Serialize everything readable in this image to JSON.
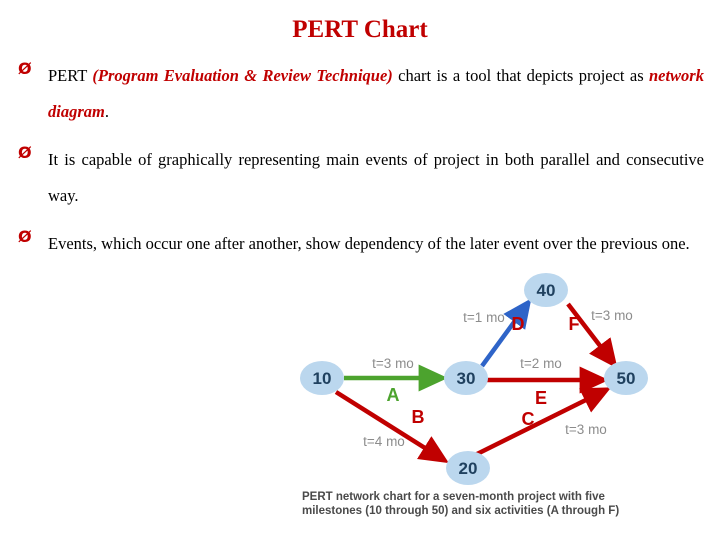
{
  "slide": {
    "title": "PERT Chart",
    "bullet_marker": "Ø",
    "bullets": [
      {
        "segments": [
          {
            "text": "PERT ",
            "style": "plain"
          },
          {
            "text": "(Program Evaluation & Review Technique)",
            "style": "red-bold-italic"
          },
          {
            "text": " chart is a tool that depicts project as ",
            "style": "plain"
          },
          {
            "text": "network diagram",
            "style": "red-bold-italic"
          },
          {
            "text": ".",
            "style": "plain"
          }
        ]
      },
      {
        "segments": [
          {
            "text": "It is capable of graphically representing main events of project in both parallel and consecutive way.",
            "style": "plain"
          }
        ]
      },
      {
        "segments": [
          {
            "text": "Events, which occur one after another, show dependency of the later event over the previous one.",
            "style": "plain"
          }
        ]
      }
    ]
  },
  "diagram": {
    "nodes": [
      {
        "id": "10",
        "label": "10"
      },
      {
        "id": "20",
        "label": "20"
      },
      {
        "id": "30",
        "label": "30"
      },
      {
        "id": "40",
        "label": "40"
      },
      {
        "id": "50",
        "label": "50"
      }
    ],
    "activities": [
      {
        "name": "A",
        "duration": "t=3 mo",
        "from": "10",
        "to": "30",
        "color": "#4CA32E"
      },
      {
        "name": "B",
        "duration": "t=4 mo",
        "from": "10",
        "to": "20",
        "color": "#C00000"
      },
      {
        "name": "C",
        "duration": "t=3 mo",
        "from": "20",
        "to": "50",
        "color": "#C00000"
      },
      {
        "name": "D",
        "duration": "t=1 mo",
        "from": "30",
        "to": "40",
        "color": "#2E64C8"
      },
      {
        "name": "E",
        "duration": "t=2 mo",
        "from": "30",
        "to": "50",
        "color": "#C00000"
      },
      {
        "name": "F",
        "duration": "t=3 mo",
        "from": "40",
        "to": "50",
        "color": "#C00000"
      }
    ],
    "caption_line1": "PERT network chart for a seven-month project with five",
    "caption_line2": "milestones (10 through 50) and six activities (A through F)"
  },
  "colors": {
    "title": "#C00000",
    "accent_red": "#C00000",
    "node_fill": "#BBD7EE",
    "node_text": "#20415F",
    "green": "#4CA32E",
    "blue": "#2E64C8",
    "label_gray": "#8C8C8C",
    "caption_gray": "#4a4a4a"
  }
}
